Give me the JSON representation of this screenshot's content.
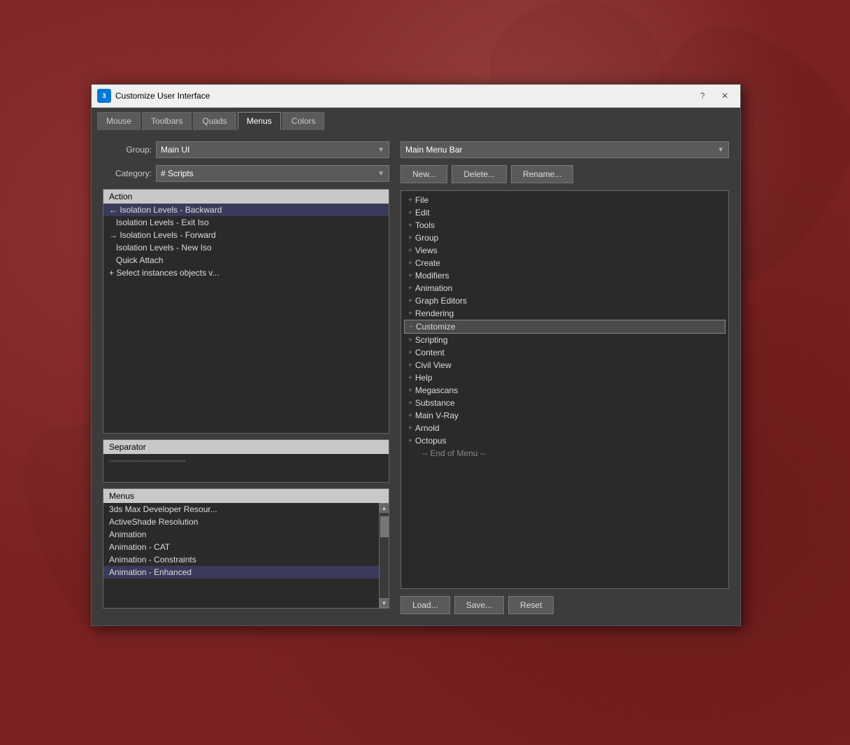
{
  "background": {
    "color": "#7a2222"
  },
  "dialog": {
    "title": "Customize User Interface",
    "icon": "3",
    "controls": {
      "help": "?",
      "close": "✕"
    }
  },
  "tabs": [
    {
      "label": "Mouse",
      "active": false
    },
    {
      "label": "Toolbars",
      "active": false
    },
    {
      "label": "Quads",
      "active": false
    },
    {
      "label": "Menus",
      "active": true
    },
    {
      "label": "Colors",
      "active": false
    }
  ],
  "left": {
    "group_label": "Group:",
    "group_value": "Main UI",
    "category_label": "Category:",
    "category_value": "# Scripts",
    "action_header": "Action",
    "action_items": [
      {
        "text": "← Isolation Levels - Backward",
        "indent": false
      },
      {
        "text": "  Isolation Levels - Exit Iso",
        "indent": true
      },
      {
        "text": "→ Isolation Levels - Forward",
        "indent": false
      },
      {
        "text": "  Isolation Levels - New Iso",
        "indent": true
      },
      {
        "text": "  Quick Attach",
        "indent": true
      },
      {
        "text": "+ Select instances objects v...",
        "indent": false
      }
    ],
    "separator_header": "Separator",
    "separator_content": "------------------------------",
    "menus_header": "Menus",
    "menus_items": [
      "3ds Max Developer Resour...",
      "ActiveShade Resolution",
      "Animation",
      "Animation - CAT",
      "Animation - Constraints",
      "Animation - Enhanced"
    ]
  },
  "right": {
    "menu_bar_value": "Main Menu Bar",
    "buttons": {
      "new": "New...",
      "delete": "Delete...",
      "rename": "Rename..."
    },
    "tree_items": [
      {
        "text": "File",
        "prefix": "+"
      },
      {
        "text": "Edit",
        "prefix": "+"
      },
      {
        "text": "Tools",
        "prefix": "+"
      },
      {
        "text": "Group",
        "prefix": "+"
      },
      {
        "text": "Views",
        "prefix": "+"
      },
      {
        "text": "Create",
        "prefix": "+"
      },
      {
        "text": "Modifiers",
        "prefix": "+"
      },
      {
        "text": "Animation",
        "prefix": "+"
      },
      {
        "text": "Graph Editors",
        "prefix": "+"
      },
      {
        "text": "Rendering",
        "prefix": "+"
      },
      {
        "text": "Customize",
        "prefix": "+",
        "highlighted": true
      },
      {
        "text": "Scripting",
        "prefix": "+"
      },
      {
        "text": "Content",
        "prefix": "+"
      },
      {
        "text": "Civil View",
        "prefix": "+"
      },
      {
        "text": "Help",
        "prefix": "+"
      },
      {
        "text": "Megascans",
        "prefix": "+"
      },
      {
        "text": "Substance",
        "prefix": "+"
      },
      {
        "text": "Main V-Ray",
        "prefix": "+"
      },
      {
        "text": "Arnold",
        "prefix": "+"
      },
      {
        "text": "Octopus",
        "prefix": "+"
      },
      {
        "text": "-- End of Menu --",
        "prefix": "",
        "indent": true
      }
    ],
    "bottom_buttons": {
      "load": "Load...",
      "save": "Save...",
      "reset": "Reset"
    }
  }
}
